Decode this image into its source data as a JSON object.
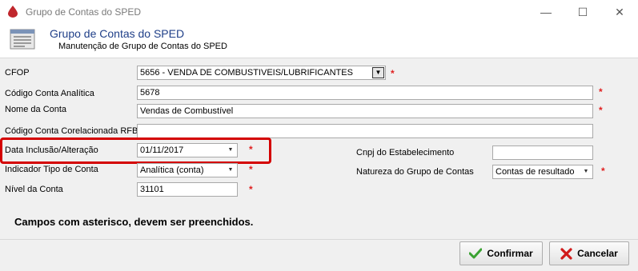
{
  "window": {
    "title": "Grupo de Contas do SPED"
  },
  "header": {
    "title": "Grupo de Contas do SPED",
    "subtitle": "Manutenção de Grupo de Contas do SPED"
  },
  "form": {
    "cfop": {
      "label": "CFOP",
      "value": "5656  - VENDA DE COMBUSTIVEIS/LUBRIFICANTES"
    },
    "codigo_conta_analitica": {
      "label": "Código Conta Analítica",
      "value": "5678"
    },
    "nome_conta": {
      "label": "Nome da Conta",
      "value": "Vendas de Combustível"
    },
    "codigo_corelacionada": {
      "label": "Código Conta Corelacionada RFB",
      "value": ""
    },
    "data_inclusao": {
      "label": "Data Inclusão/Alteração",
      "value": "01/11/2017"
    },
    "indicador_tipo": {
      "label": "Indicador Tipo de Conta",
      "value": "Analítica (conta)"
    },
    "nivel_conta": {
      "label": "Nível da Conta",
      "value": "31101"
    },
    "cnpj": {
      "label": "Cnpj do Estabelecimento",
      "value": ""
    },
    "natureza_grupo": {
      "label": "Natureza do Grupo de Contas",
      "value": "Contas de resultado"
    },
    "required_marker": "*",
    "note": "Campos com asterisco, devem ser preenchidos."
  },
  "buttons": {
    "confirmar": "Confirmar",
    "cancelar": "Cancelar"
  },
  "colors": {
    "header_title": "#1f3f88",
    "required": "#e02020",
    "highlight": "#d40000",
    "form_bg": "#f0f0f0"
  },
  "icons": [
    "app-drop-icon",
    "form-header-icon",
    "minimize-icon",
    "maximize-icon",
    "close-icon",
    "checkmark-icon",
    "x-cancel-icon",
    "dropdown-arrow-icon"
  ]
}
